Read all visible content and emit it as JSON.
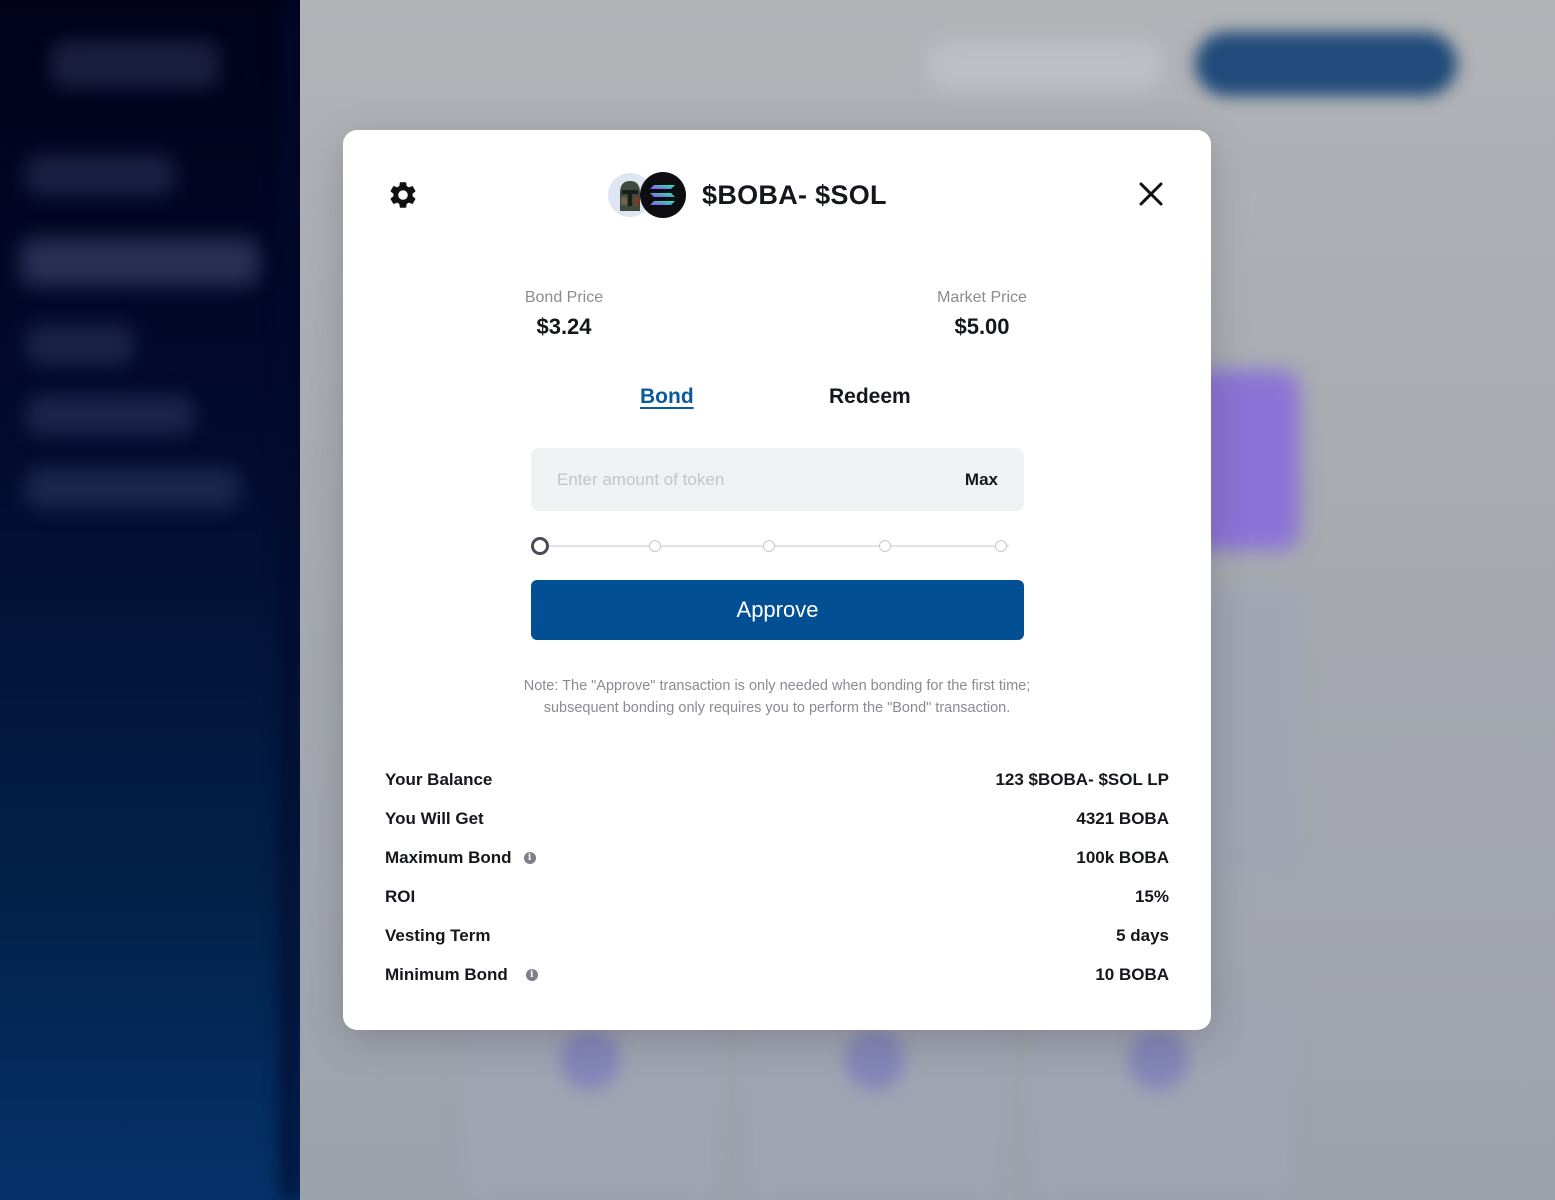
{
  "modal": {
    "pair_title": "$BOBA- $SOL",
    "bond_price_label": "Bond Price",
    "bond_price_value": "$3.24",
    "market_price_label": "Market Price",
    "market_price_value": "$5.00",
    "tabs": [
      {
        "label": "Bond",
        "active": true
      },
      {
        "label": "Redeem",
        "active": false
      }
    ],
    "amount_placeholder": "Enter amount of token",
    "max_label": "Max",
    "slider_value_percent": 0,
    "approve_label": "Approve",
    "note_line1": "Note: The \"Approve\" transaction is only needed when bonding for the first time;",
    "note_line2": "subsequent bonding only requires you to perform the \"Bond\" transaction.",
    "details": [
      {
        "label": "Your Balance",
        "value": "123 $BOBA- $SOL LP",
        "info": false
      },
      {
        "label": "You Will Get",
        "value": "4321 BOBA",
        "info": false
      },
      {
        "label": "Maximum Bond",
        "value": "100k BOBA",
        "info": true
      },
      {
        "label": "ROI",
        "value": "15%",
        "info": false
      },
      {
        "label": "Vesting Term",
        "value": "5 days",
        "info": false
      },
      {
        "label": "Minimum Bond",
        "value": "10 BOBA",
        "info": true
      }
    ]
  },
  "icons": {
    "settings": "gear-icon",
    "close": "close-icon",
    "token_a": "boba-token-icon",
    "token_b": "solana-token-icon",
    "info": "info-icon"
  },
  "colors": {
    "primary": "#024f94",
    "active_tab": "#0b5a9c",
    "text": "#15171c",
    "muted": "#8a8c92"
  }
}
